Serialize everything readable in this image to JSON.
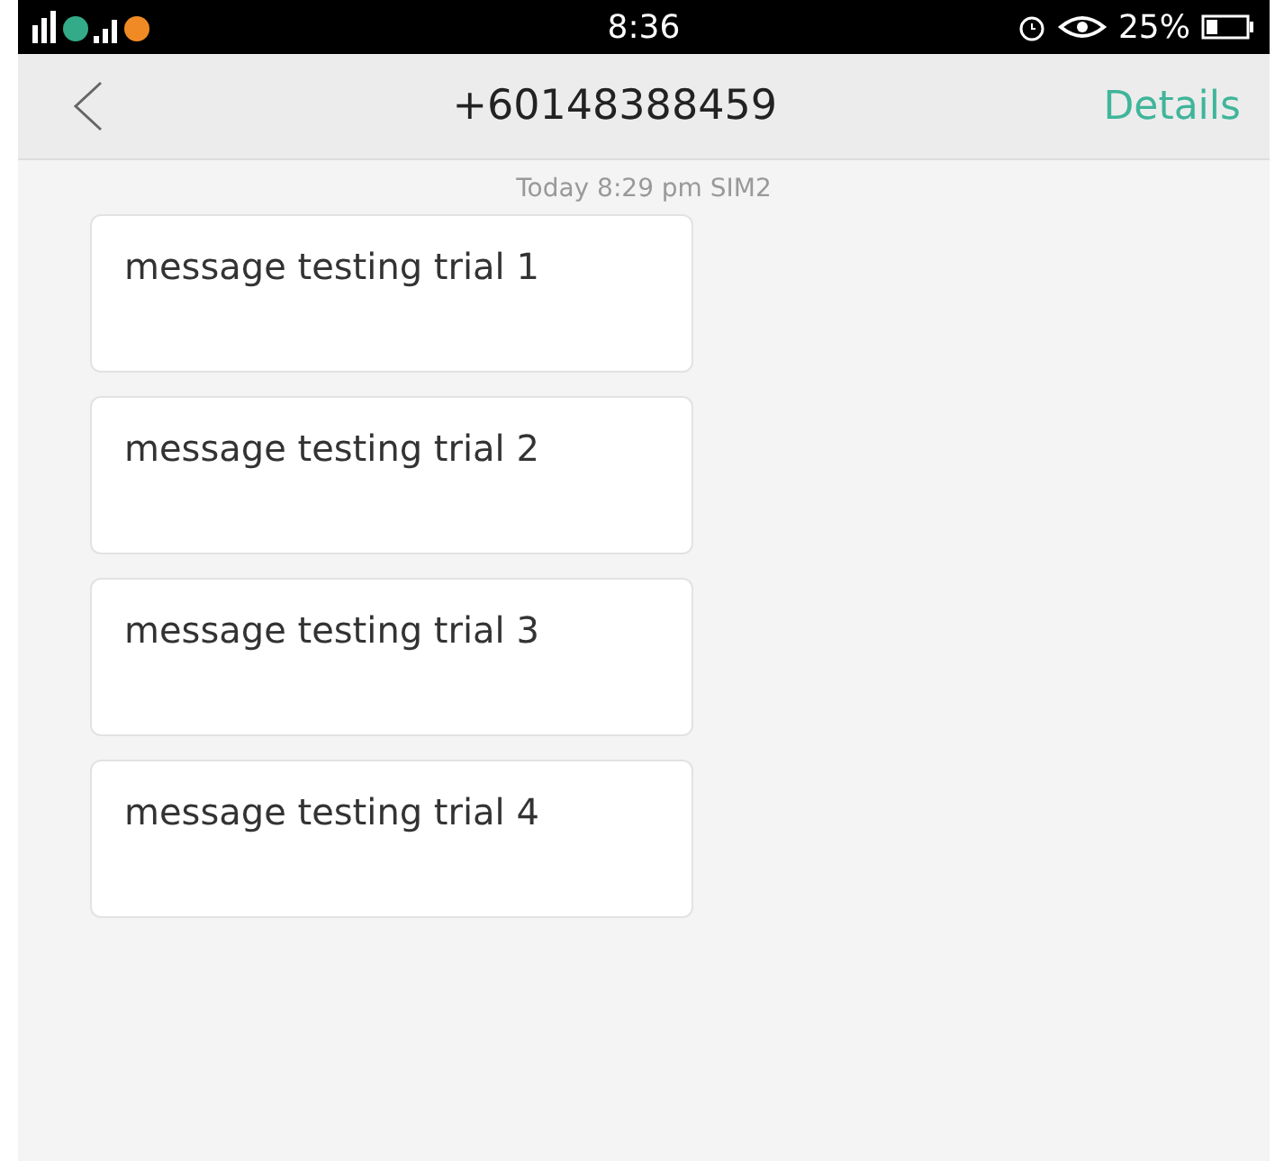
{
  "status_bar": {
    "time": "8:36",
    "battery": "25%"
  },
  "header": {
    "title": "+60148388459",
    "action": "Details"
  },
  "timestamp": "Today  8:29 pm  SIM2",
  "messages": [
    {
      "text": "message testing trial 1"
    },
    {
      "text": "message testing trial 2"
    },
    {
      "text": "message testing trial 3"
    },
    {
      "text": "message testing trial 4"
    }
  ]
}
